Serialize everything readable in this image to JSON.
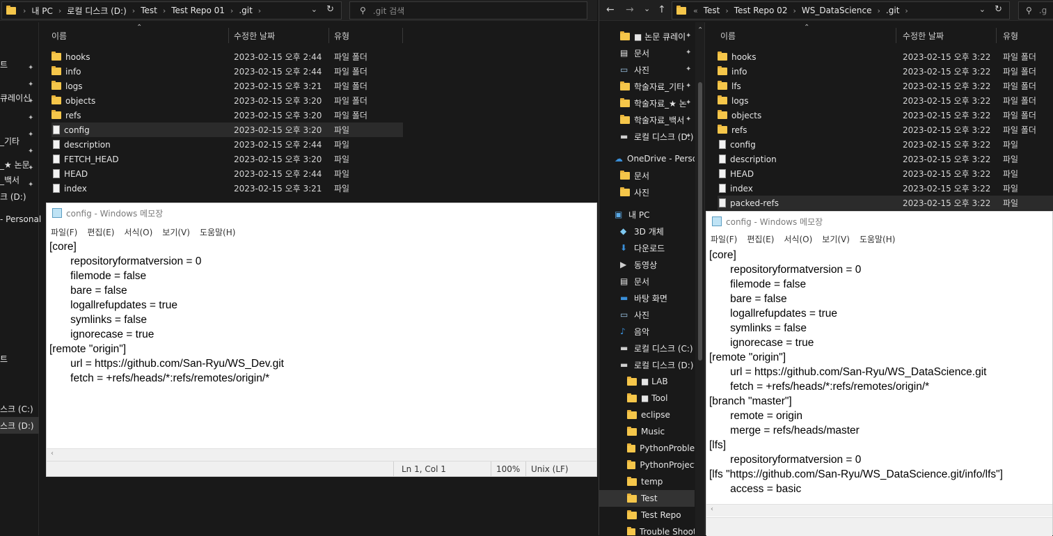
{
  "left_explorer": {
    "breadcrumb": [
      "내 PC",
      "로컬 디스크 (D:)",
      "Test",
      "Test Repo 01",
      ".git"
    ],
    "search_placeholder": ".git 검색",
    "columns": {
      "name": "이름",
      "date": "수정한 날짜",
      "type": "유형"
    },
    "nav_fragments": [
      "트",
      "큐레이신",
      "_기타",
      "_★ 논문",
      "_백서",
      "크 (D:)",
      "- Personal",
      "트",
      "스크 (C:)",
      "스크 (D:)"
    ],
    "files": [
      {
        "name": "hooks",
        "date": "2023-02-15 오후 2:44",
        "type": "파일 폴더",
        "kind": "folder"
      },
      {
        "name": "info",
        "date": "2023-02-15 오후 2:44",
        "type": "파일 폴더",
        "kind": "folder"
      },
      {
        "name": "logs",
        "date": "2023-02-15 오후 3:21",
        "type": "파일 폴더",
        "kind": "folder"
      },
      {
        "name": "objects",
        "date": "2023-02-15 오후 3:20",
        "type": "파일 폴더",
        "kind": "folder"
      },
      {
        "name": "refs",
        "date": "2023-02-15 오후 3:20",
        "type": "파일 폴더",
        "kind": "folder"
      },
      {
        "name": "config",
        "date": "2023-02-15 오후 3:20",
        "type": "파일",
        "kind": "file",
        "selected": true
      },
      {
        "name": "description",
        "date": "2023-02-15 오후 2:44",
        "type": "파일",
        "kind": "file"
      },
      {
        "name": "FETCH_HEAD",
        "date": "2023-02-15 오후 3:20",
        "type": "파일",
        "kind": "file"
      },
      {
        "name": "HEAD",
        "date": "2023-02-15 오후 2:44",
        "type": "파일",
        "kind": "file"
      },
      {
        "name": "index",
        "date": "2023-02-15 오후 3:21",
        "type": "파일",
        "kind": "file"
      }
    ]
  },
  "left_notepad": {
    "title": "config - Windows 메모장",
    "menu": [
      "파일(F)",
      "편집(E)",
      "서식(O)",
      "보기(V)",
      "도움말(H)"
    ],
    "content": "[core]\n\trepositoryformatversion = 0\n\tfilemode = false\n\tbare = false\n\tlogallrefupdates = true\n\tsymlinks = false\n\tignorecase = true\n[remote \"origin\"]\n\turl = https://github.com/San-Ryu/WS_Dev.git\n\tfetch = +refs/heads/*:refs/remotes/origin/*",
    "status": {
      "position": "Ln 1, Col 1",
      "zoom": "100%",
      "eol": "Unix (LF)"
    }
  },
  "right_explorer": {
    "breadcrumb": [
      "Test",
      "Test Repo 02",
      "WS_DataScience",
      ".git"
    ],
    "search_placeholder": ".g",
    "columns": {
      "name": "이름",
      "date": "수정한 날짜",
      "type": "유형"
    },
    "nav": [
      {
        "label": "■ 논문 큐레이",
        "icon": "folder",
        "pinned": true
      },
      {
        "label": "문서",
        "icon": "document",
        "pinned": true
      },
      {
        "label": "사진",
        "icon": "pictures",
        "pinned": true
      },
      {
        "label": "학술자료_기타",
        "icon": "folder",
        "pinned": true
      },
      {
        "label": "학술자료_★ 논",
        "icon": "folder",
        "pinned": true
      },
      {
        "label": "학술자료_백서",
        "icon": "folder",
        "pinned": true
      },
      {
        "label": "로컬 디스크 (D:)",
        "icon": "drive",
        "pinned": true
      },
      {
        "label": "OneDrive - Personal",
        "icon": "cloud",
        "pinned": false
      },
      {
        "label": "문서",
        "icon": "folder",
        "pinned": false
      },
      {
        "label": "사진",
        "icon": "folder",
        "pinned": false
      },
      {
        "label": "내 PC",
        "icon": "pc",
        "pinned": false
      },
      {
        "label": "3D 개체",
        "icon": "3d",
        "pinned": false
      },
      {
        "label": "다운로드",
        "icon": "download",
        "pinned": false
      },
      {
        "label": "동영상",
        "icon": "video",
        "pinned": false
      },
      {
        "label": "문서",
        "icon": "document",
        "pinned": false
      },
      {
        "label": "바탕 화면",
        "icon": "desktop",
        "pinned": false
      },
      {
        "label": "사진",
        "icon": "pictures",
        "pinned": false
      },
      {
        "label": "음악",
        "icon": "music",
        "pinned": false
      },
      {
        "label": "로컬 디스크 (C:)",
        "icon": "drive",
        "pinned": false
      },
      {
        "label": "로컬 디스크 (D:)",
        "icon": "drive",
        "pinned": false
      },
      {
        "label": "■ LAB",
        "icon": "folder",
        "pinned": false
      },
      {
        "label": "■ Tool",
        "icon": "folder",
        "pinned": false
      },
      {
        "label": "eclipse",
        "icon": "folder",
        "pinned": false
      },
      {
        "label": "Music",
        "icon": "folder",
        "pinned": false
      },
      {
        "label": "PythonProblem",
        "icon": "folder",
        "pinned": false
      },
      {
        "label": "PythonProjects",
        "icon": "folder",
        "pinned": false
      },
      {
        "label": "temp",
        "icon": "folder",
        "pinned": false
      },
      {
        "label": "Test",
        "icon": "folder",
        "pinned": false,
        "selected": true
      },
      {
        "label": "Test Repo",
        "icon": "folder",
        "pinned": false
      },
      {
        "label": "Trouble Shooter",
        "icon": "folder",
        "pinned": false
      }
    ],
    "files": [
      {
        "name": "hooks",
        "date": "2023-02-15 오후 3:22",
        "type": "파일 폴더",
        "kind": "folder"
      },
      {
        "name": "info",
        "date": "2023-02-15 오후 3:22",
        "type": "파일 폴더",
        "kind": "folder"
      },
      {
        "name": "lfs",
        "date": "2023-02-15 오후 3:22",
        "type": "파일 폴더",
        "kind": "folder"
      },
      {
        "name": "logs",
        "date": "2023-02-15 오후 3:22",
        "type": "파일 폴더",
        "kind": "folder"
      },
      {
        "name": "objects",
        "date": "2023-02-15 오후 3:22",
        "type": "파일 폴더",
        "kind": "folder"
      },
      {
        "name": "refs",
        "date": "2023-02-15 오후 3:22",
        "type": "파일 폴더",
        "kind": "folder"
      },
      {
        "name": "config",
        "date": "2023-02-15 오후 3:22",
        "type": "파일",
        "kind": "file"
      },
      {
        "name": "description",
        "date": "2023-02-15 오후 3:22",
        "type": "파일",
        "kind": "file"
      },
      {
        "name": "HEAD",
        "date": "2023-02-15 오후 3:22",
        "type": "파일",
        "kind": "file"
      },
      {
        "name": "index",
        "date": "2023-02-15 오후 3:22",
        "type": "파일",
        "kind": "file"
      },
      {
        "name": "packed-refs",
        "date": "2023-02-15 오후 3:22",
        "type": "파일",
        "kind": "file",
        "selected": true
      }
    ]
  },
  "right_notepad": {
    "title": "config - Windows 메모장",
    "menu": [
      "파일(F)",
      "편집(E)",
      "서식(O)",
      "보기(V)",
      "도움말(H)"
    ],
    "content": "[core]\n\trepositoryformatversion = 0\n\tfilemode = false\n\tbare = false\n\tlogallrefupdates = true\n\tsymlinks = false\n\tignorecase = true\n[remote \"origin\"]\n\turl = https://github.com/San-Ryu/WS_DataScience.git\n\tfetch = +refs/heads/*:refs/remotes/origin/*\n[branch \"master\"]\n\tremote = origin\n\tmerge = refs/heads/master\n[lfs]\n\trepositoryformatversion = 0\n[lfs \"https://github.com/San-Ryu/WS_DataScience.git/info/lfs\"]\n\taccess = basic"
  }
}
